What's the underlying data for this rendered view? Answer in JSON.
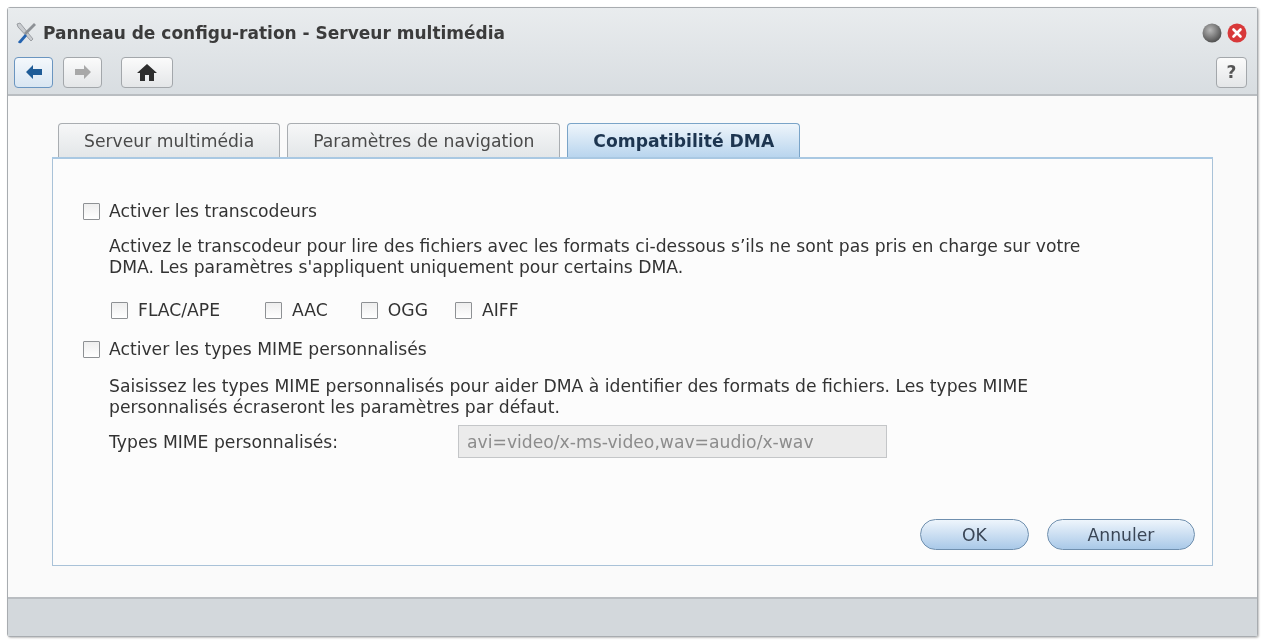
{
  "window": {
    "title": "Panneau de configu-ration - Serveur multimédia"
  },
  "toolbar": [
    {
      "kind": "back",
      "disabled": false
    },
    {
      "kind": "forward",
      "disabled": true
    },
    {
      "kind": "home",
      "disabled": false
    }
  ],
  "help": {
    "label": "?"
  },
  "tabs": [
    {
      "label": "Serveur multimédia",
      "selected": false
    },
    {
      "label": "Paramètres de navigation",
      "selected": false
    },
    {
      "label": "Compatibilité DMA",
      "selected": true
    }
  ],
  "transcoders": {
    "label": "Activer les transcodeurs",
    "checked": false,
    "description": "Activez le transcodeur pour lire des fichiers avec les formats ci-dessous s’ils ne sont pas pris en charge sur votre DMA. Les paramètres s'appliquent uniquement pour certains DMA.",
    "formats": [
      {
        "label": "FLAC/APE",
        "checked": false
      },
      {
        "label": "AAC",
        "checked": false
      },
      {
        "label": "OGG",
        "checked": false
      },
      {
        "label": "AIFF",
        "checked": false
      }
    ]
  },
  "mime": {
    "label": "Activer les types MIME personnalisés",
    "checked": false,
    "description": "Saisissez les types MIME personnalisés pour aider DMA à identifier des formats de fichiers. Les types MIME personnalisés écraseront les paramètres par défaut.",
    "field_label": "Types MIME personnalisés:",
    "field_value": "avi=video/x-ms-video,wav=audio/x-wav",
    "field_disabled": true
  },
  "buttons": [
    "OK",
    "Annuler"
  ]
}
